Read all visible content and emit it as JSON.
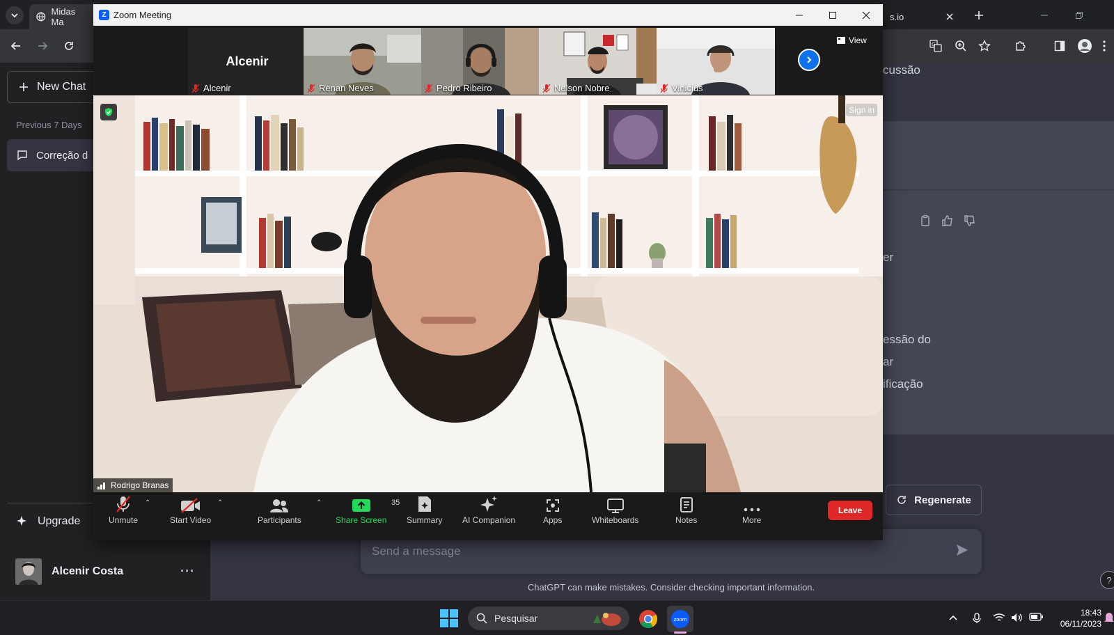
{
  "browser": {
    "tabs": [
      {
        "title": "Midas Ma",
        "active": true
      },
      {
        "title": "s.io",
        "active": false
      }
    ],
    "icons": [
      "tab-search-icon",
      "globe-icon",
      "close-icon",
      "plus-icon",
      "back-icon",
      "forward-icon",
      "reload-icon",
      "translate-icon",
      "zoom-icon",
      "star-icon",
      "extensions-icon",
      "side-panel-icon",
      "profile-icon",
      "kebab-icon"
    ]
  },
  "chatgpt": {
    "sidebar": {
      "new_chat": "New Chat",
      "section_label": "Previous 7 Days",
      "conversation": "Correção d",
      "upgrade": "Upgrade",
      "user_name": "Alcenir Costa",
      "more": "···"
    },
    "main": {
      "snippets": [
        "cussão",
        "er",
        "essão do",
        "ar",
        "ificação"
      ],
      "regenerate": "Regenerate",
      "message_placeholder": "Send a message",
      "disclaimer": "ChatGPT can make mistakes. Consider checking important information.",
      "help": "?"
    }
  },
  "zoom": {
    "window_title": "Zoom Meeting",
    "view_label": "View",
    "sign_in": "Sign in",
    "participants_strip": [
      {
        "name": "Alcenir",
        "display": "Alcenir",
        "video": false,
        "muted": true
      },
      {
        "name": "Renan Neves",
        "video": true,
        "muted": true
      },
      {
        "name": "Pedro Ribeiro",
        "video": true,
        "muted": true
      },
      {
        "name": "Nelson Nobre",
        "video": true,
        "muted": true
      },
      {
        "name": "Vinicius",
        "video": true,
        "muted": true
      }
    ],
    "active_speaker": "Rodrigo Branas",
    "toolbar": {
      "unmute": "Unmute",
      "start_video": "Start Video",
      "participants": "Participants",
      "participants_count": "35",
      "share_screen": "Share Screen",
      "summary": "Summary",
      "ai_companion": "AI Companion",
      "apps": "Apps",
      "whiteboards": "Whiteboards",
      "notes": "Notes",
      "more": "More",
      "leave": "Leave"
    },
    "colors": {
      "share_green": "#23d959",
      "leave_red": "#e02828",
      "accent_blue": "#0e72ed"
    }
  },
  "taskbar": {
    "search_placeholder": "Pesquisar",
    "time": "18:43",
    "date": "06/11/2023"
  }
}
